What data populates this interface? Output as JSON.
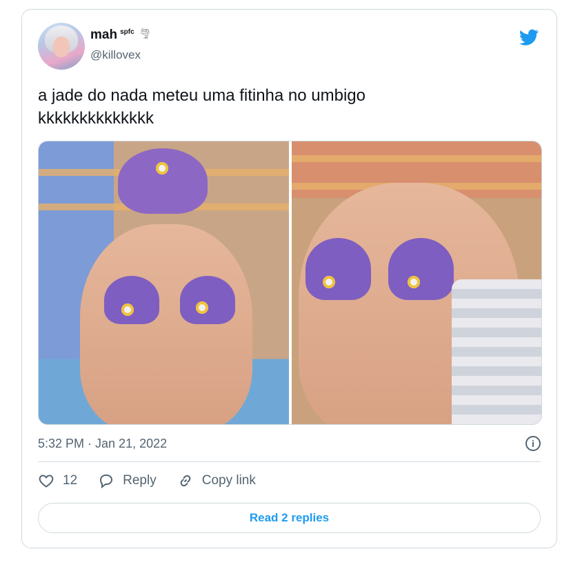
{
  "author": {
    "name": "mah",
    "name_tag": "spfc",
    "handle": "@killovex"
  },
  "tweet": {
    "text": "a jade do nada meteu uma fitinha no umbigo\nkkkkkkkkkkkkkk",
    "timestamp": "5:32 PM · Jan 21, 2022"
  },
  "icons": {
    "brand": "twitter-bird-icon",
    "tornado": "tornado-emoji-icon",
    "info": "info-icon",
    "like": "heart-icon",
    "reply": "speech-bubble-icon",
    "copy": "link-icon"
  },
  "actions": {
    "like_count": "12",
    "reply_label": "Reply",
    "copy_label": "Copy link"
  },
  "read_replies_label": "Read 2 replies",
  "colors": {
    "accent": "#1d9bf0",
    "muted": "#536471",
    "border": "#cfd9de"
  }
}
